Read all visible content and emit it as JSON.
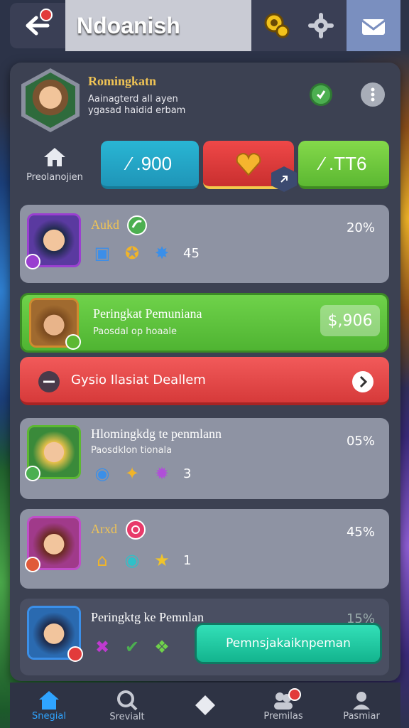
{
  "header": {
    "title": "Ndoanish"
  },
  "profile": {
    "name": "Romingkatn",
    "sub_line1": "Aainagterd all ayen",
    "sub_line2": "ygasad haidid erbam"
  },
  "home_label": "Preolanojien",
  "stats": {
    "blue": "⁄ .900",
    "green": "⁄ .TT6"
  },
  "rows": [
    {
      "title": "Aukd",
      "pct": "20%",
      "count": "45"
    },
    {
      "title": "Peringkat Pemuniana",
      "sub": "Paosdal op hoaale",
      "value": "$,906"
    },
    {
      "title": "Gysio Ilasiat Deallem"
    },
    {
      "title": "Hlomingkdg te penmlann",
      "sub": "Paosdklon tionala",
      "pct": "05%",
      "count": "3"
    },
    {
      "title": "Arxd",
      "pct": "45%",
      "count": "1"
    },
    {
      "title": "Peringktg ke Pemnlan",
      "pct": "15%"
    }
  ],
  "cta_label": "Pemnsjakaiknpeman",
  "nav": [
    {
      "label": "Snegial",
      "icon": "home-icon"
    },
    {
      "label": "Srevialt",
      "icon": "search-icon"
    },
    {
      "label": "",
      "icon": "diamond-icon"
    },
    {
      "label": "Premilas",
      "icon": "group-icon"
    },
    {
      "label": "Pasmiar",
      "icon": "profile-icon"
    }
  ],
  "colors": {
    "accent_blue": "#2fa4ff",
    "gold": "#f0c455",
    "green": "#5cb832",
    "red": "#d63a3a",
    "teal": "#13b48e"
  }
}
